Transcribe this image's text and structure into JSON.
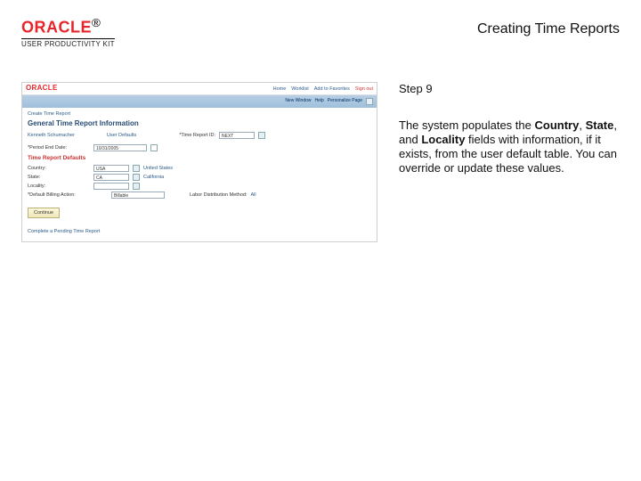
{
  "header": {
    "logo_text": "ORACLE",
    "logo_tm": "®",
    "upk": "USER PRODUCTIVITY KIT",
    "title": "Creating Time Reports"
  },
  "screenshot": {
    "logo": "ORACLE",
    "nav": {
      "home": "Home",
      "worklist": "Worklist",
      "addfav": "Add to Favorites",
      "signout": "Sign out"
    },
    "secondbar": {
      "newwin": "New Window",
      "help": "Help",
      "personalize": "Personalize Page"
    },
    "breadcrumb": "Create Time Report",
    "section_title": "General Time Report Information",
    "name_label": "Kenneth Schumacher",
    "user_defaults": "User Defaults",
    "time_report_id_label": "*Time Report ID:",
    "time_report_id_value": "NEXT",
    "period_label": "*Period End Date:",
    "period_value": "10/31/2005",
    "calendar_icon": "calendar-icon",
    "default_title": "Time Report Defaults",
    "country_label": "Country:",
    "country_value": "USA",
    "country_link": "United States",
    "state_label": "State:",
    "state_value": "CA",
    "state_link": "California",
    "locality_label": "Locality:",
    "locality_value": "",
    "billing_label": "*Default Billing Action:",
    "billing_value": "Billable",
    "labor_label": "Labor Distribution Method:",
    "labor_link": "All",
    "continue": "Continue",
    "pending": "Complete a Pending Time Report"
  },
  "right": {
    "step": "Step 9",
    "body_pre": "The system populates the ",
    "b1": "Country",
    "mid1": ", ",
    "b2": "State",
    "mid2": ", and ",
    "b3": "Locality",
    "body_post": " fields with information, if it exists, from the user default table. You can override or update these values."
  }
}
